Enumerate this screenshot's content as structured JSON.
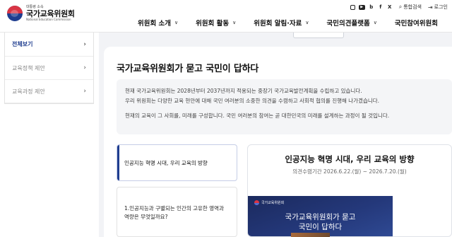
{
  "header": {
    "logo": {
      "sub": "대통령 소속",
      "main": "국가교육위원회",
      "en": "National Education Commission"
    },
    "social": [
      {
        "icon": "instagram-icon",
        "glyph": ""
      },
      {
        "icon": "youtube-icon",
        "glyph": "▶"
      },
      {
        "icon": "blog-icon",
        "glyph": "b"
      },
      {
        "icon": "facebook-icon",
        "glyph": "f"
      },
      {
        "icon": "x-icon",
        "glyph": "X"
      }
    ],
    "search_label": "통합검색",
    "login_label": "로그인",
    "nav": [
      {
        "label": "위원회 소개"
      },
      {
        "label": "위원회 활동"
      },
      {
        "label": "위원회 알림·자료"
      },
      {
        "label": "국민의견플랫폼"
      },
      {
        "label": "국민참여위원회"
      }
    ]
  },
  "sidebar": {
    "items": [
      {
        "label": "전체보기"
      },
      {
        "label": "교육정책 제안"
      },
      {
        "label": "교육과정 제안"
      }
    ]
  },
  "main": {
    "title": "국가교육위원회가 묻고 국민이 답하다",
    "intro": [
      "현재 국가교육위원회는 2028년부터 2037년까지 적용되는 중장기 국가교육발전계획을 수립하고 있습니다.",
      "우리 위원회는 다양한 교육 현안에 대해 국민 여러분의 소중한 의견을 수렴하고 사회적 협의를 진행해 나가겠습니다.",
      "현재의 교육이 그 사회를, 미래를 구성합니다. 국민 여러분의 참여는 곧 대한민국의 미래를 설계하는 과정이 될 것입니다."
    ],
    "questions": [
      {
        "label": "인공지능 혁명 시대, 우리 교육의 방향"
      },
      {
        "label_line1": "1.인공지능과 구별되는 인간의 고유한 영역과",
        "label_line2": "역량은 무엇일까요?"
      }
    ],
    "feature": {
      "title": "인공지능 혁명 시대, 우리 교육의 방향",
      "period": "의견수렴기간 2026.6.22.(월) ~ 2026.7.20.(월)",
      "banner": {
        "logo_text": "국가교육위원회",
        "headline_1": "국가교육위원회가 묻고",
        "headline_2": "국민이 답하다"
      }
    }
  },
  "colors": {
    "accent": "#1f3d8f",
    "banner": "#1b2a5e",
    "background": "#f2f3f6"
  }
}
